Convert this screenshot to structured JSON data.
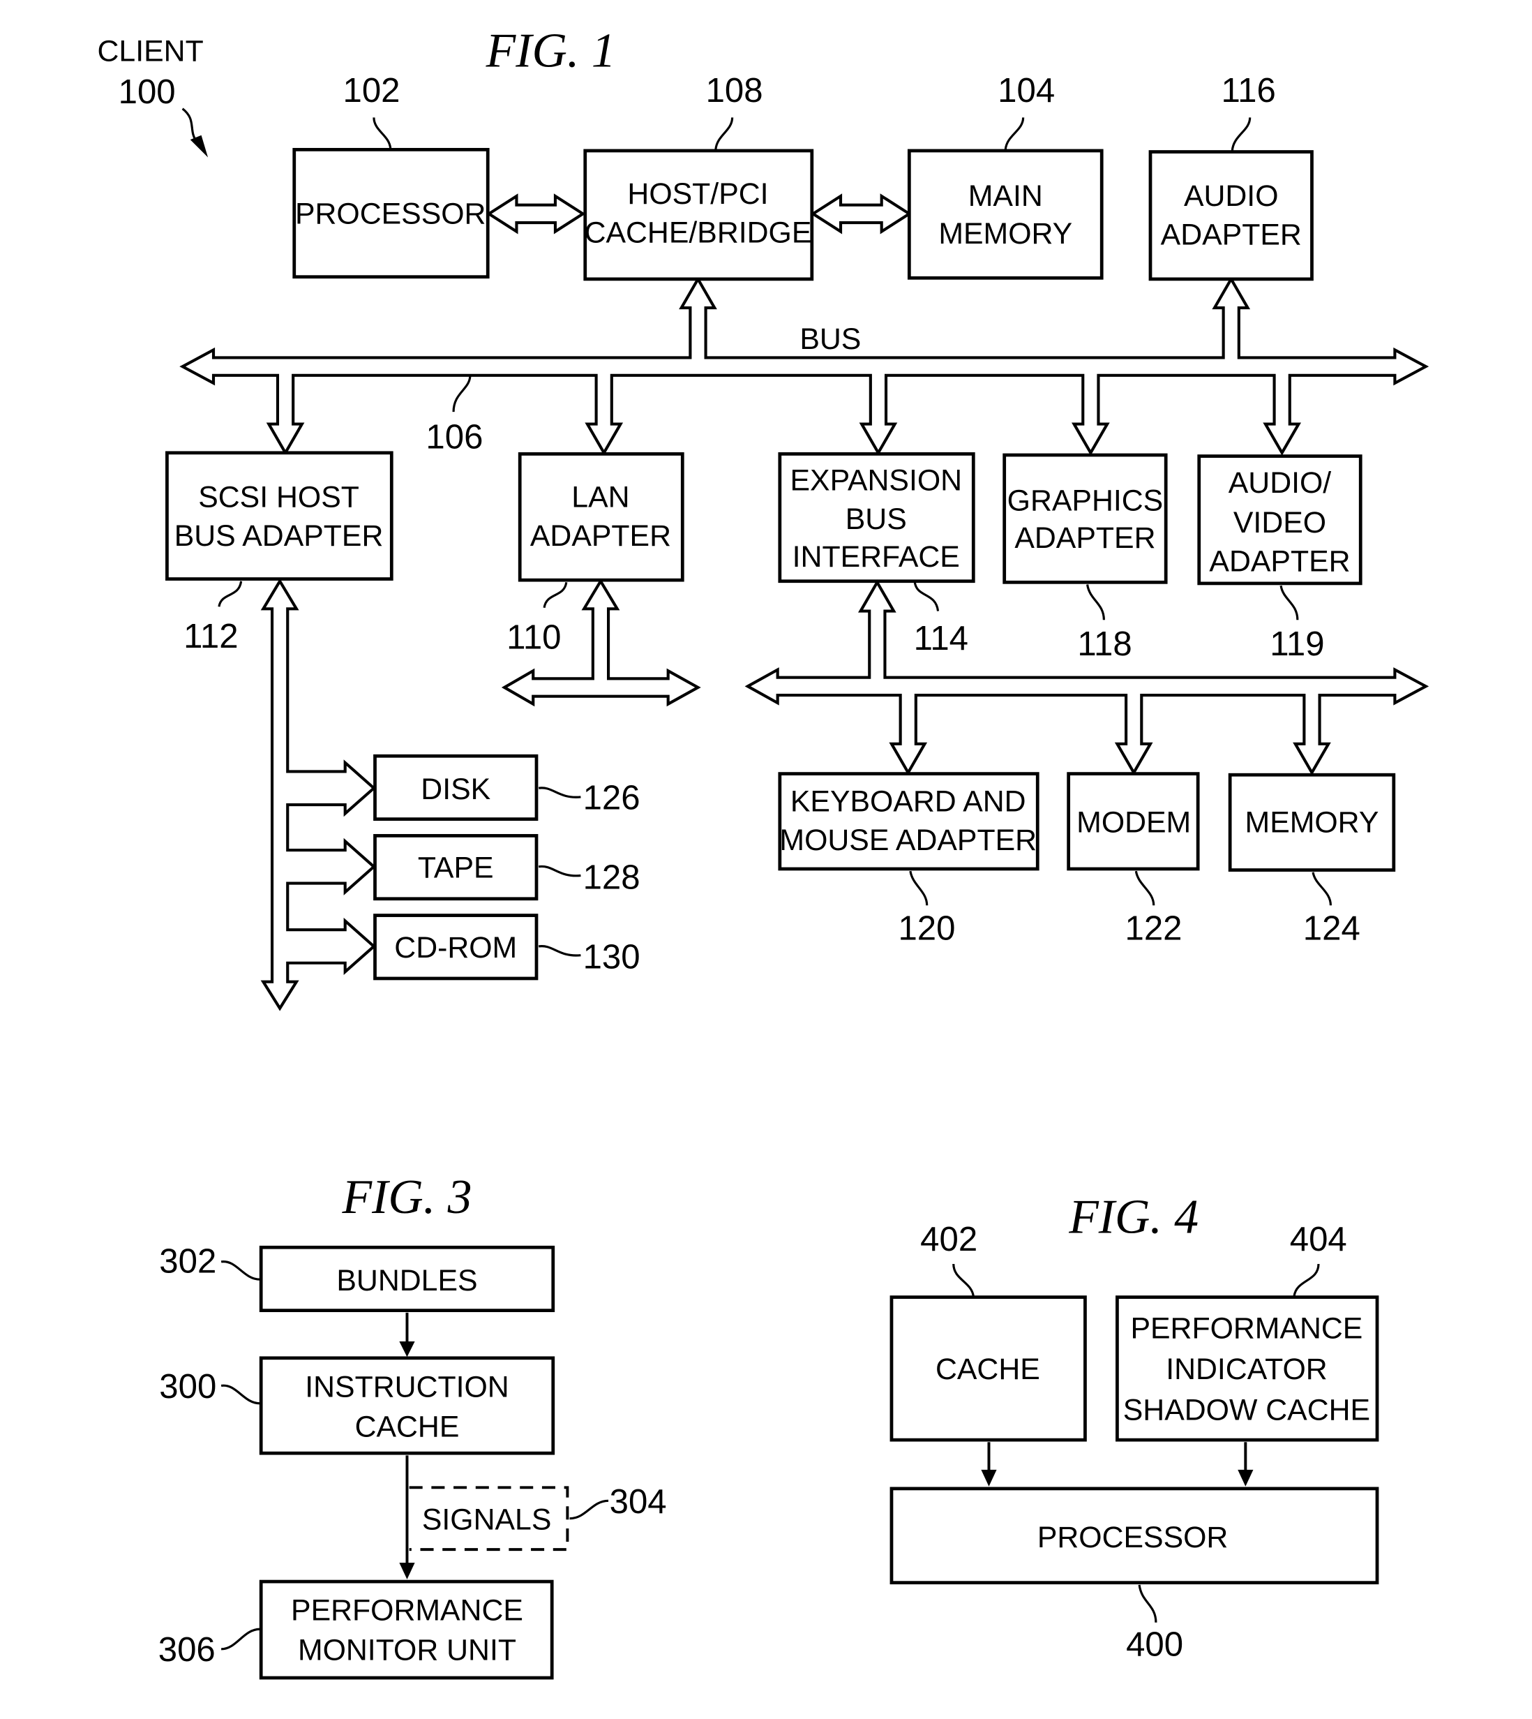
{
  "fig1": {
    "title": "FIG. 1",
    "client_label": "CLIENT",
    "client_ref": "100",
    "bus_label": "BUS",
    "bus_ref": "106",
    "blocks": {
      "processor": {
        "lines": [
          "PROCESSOR"
        ],
        "ref": "102"
      },
      "host_bridge": {
        "lines": [
          "HOST/PCI",
          "CACHE/BRIDGE"
        ],
        "ref": "108"
      },
      "main_memory": {
        "lines": [
          "MAIN",
          "MEMORY"
        ],
        "ref": "104"
      },
      "audio_adapter": {
        "lines": [
          "AUDIO",
          "ADAPTER"
        ],
        "ref": "116"
      },
      "scsi": {
        "lines": [
          "SCSI HOST",
          "BUS ADAPTER"
        ],
        "ref": "112"
      },
      "lan": {
        "lines": [
          "LAN",
          "ADAPTER"
        ],
        "ref": "110"
      },
      "expansion": {
        "lines": [
          "EXPANSION",
          "BUS",
          "INTERFACE"
        ],
        "ref": "114"
      },
      "graphics": {
        "lines": [
          "GRAPHICS",
          "ADAPTER"
        ],
        "ref": "118"
      },
      "av_adapter": {
        "lines": [
          "AUDIO/",
          "VIDEO",
          "ADAPTER"
        ],
        "ref": "119"
      },
      "disk": {
        "lines": [
          "DISK"
        ],
        "ref": "126"
      },
      "tape": {
        "lines": [
          "TAPE"
        ],
        "ref": "128"
      },
      "cdrom": {
        "lines": [
          "CD-ROM"
        ],
        "ref": "130"
      },
      "keyboard": {
        "lines": [
          "KEYBOARD AND",
          "MOUSE ADAPTER"
        ],
        "ref": "120"
      },
      "modem": {
        "lines": [
          "MODEM"
        ],
        "ref": "122"
      },
      "memory": {
        "lines": [
          "MEMORY"
        ],
        "ref": "124"
      }
    }
  },
  "fig3": {
    "title": "FIG. 3",
    "blocks": {
      "bundles": {
        "lines": [
          "BUNDLES"
        ],
        "ref": "302"
      },
      "icache": {
        "lines": [
          "INSTRUCTION",
          "CACHE"
        ],
        "ref": "300"
      },
      "signals": {
        "lines": [
          "SIGNALS"
        ],
        "ref": "304"
      },
      "pmu": {
        "lines": [
          "PERFORMANCE",
          "MONITOR UNIT"
        ],
        "ref": "306"
      }
    }
  },
  "fig4": {
    "title": "FIG. 4",
    "blocks": {
      "cache": {
        "lines": [
          "CACHE"
        ],
        "ref": "402"
      },
      "shadow": {
        "lines": [
          "PERFORMANCE",
          "INDICATOR",
          "SHADOW CACHE"
        ],
        "ref": "404"
      },
      "processor": {
        "lines": [
          "PROCESSOR"
        ],
        "ref": "400"
      }
    }
  }
}
